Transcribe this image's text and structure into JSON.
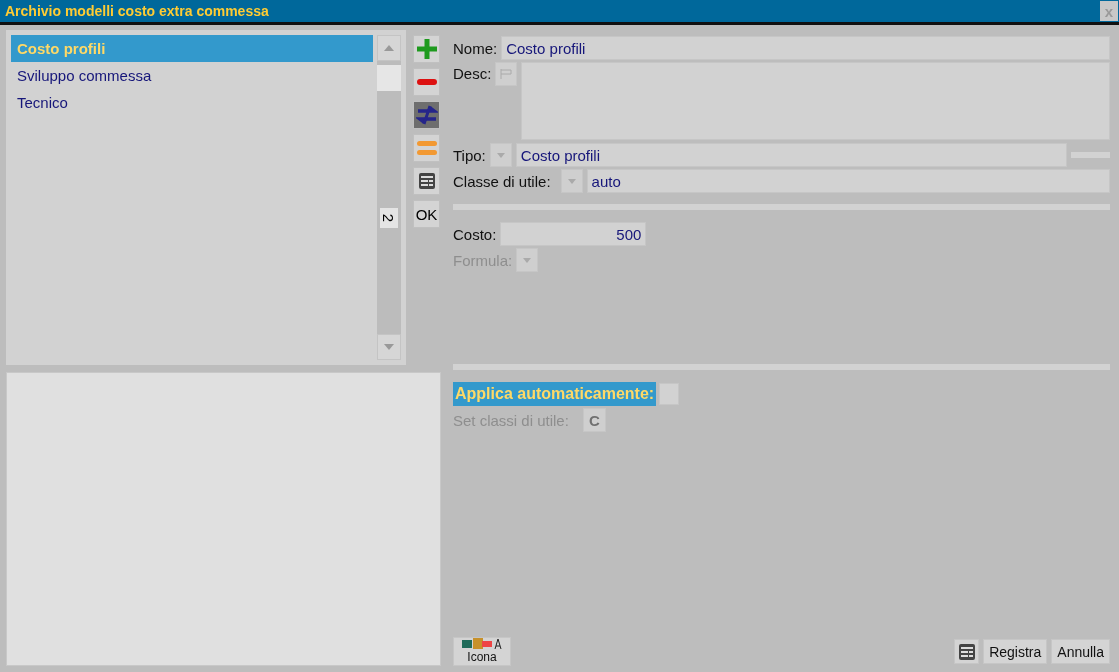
{
  "window": {
    "title": "Archivio modelli costo extra commessa",
    "close": "x"
  },
  "list": {
    "items": [
      {
        "label": "Costo profili",
        "selected": true
      },
      {
        "label": "Sviluppo commessa",
        "selected": false
      },
      {
        "label": "Tecnico",
        "selected": false
      }
    ],
    "scroll_marker": "2"
  },
  "toolbar": [
    {
      "kind": "add"
    },
    {
      "kind": "remove"
    },
    {
      "kind": "swap",
      "selected": true
    },
    {
      "kind": "equal"
    },
    {
      "kind": "table"
    },
    {
      "kind": "text",
      "label": "OK"
    }
  ],
  "form": {
    "nome": {
      "label": "Nome:",
      "value": "Costo profili"
    },
    "desc": {
      "label": "Desc:"
    },
    "tipo": {
      "label": "Tipo:",
      "value": "Costo profili"
    },
    "classe": {
      "label": "Classe di utile:",
      "value": "auto"
    },
    "costo": {
      "label": "Costo:",
      "value": "500"
    },
    "formula": {
      "label": "Formula:",
      "disabled": true
    },
    "applica": {
      "label": "Applica automaticamente:",
      "checked": false
    },
    "set_classi": {
      "label": "Set classi di utile:",
      "button": "C",
      "disabled": true
    }
  },
  "footer": {
    "icon_button": "Icona",
    "buttons": [
      "Registra",
      "Annulla"
    ]
  }
}
